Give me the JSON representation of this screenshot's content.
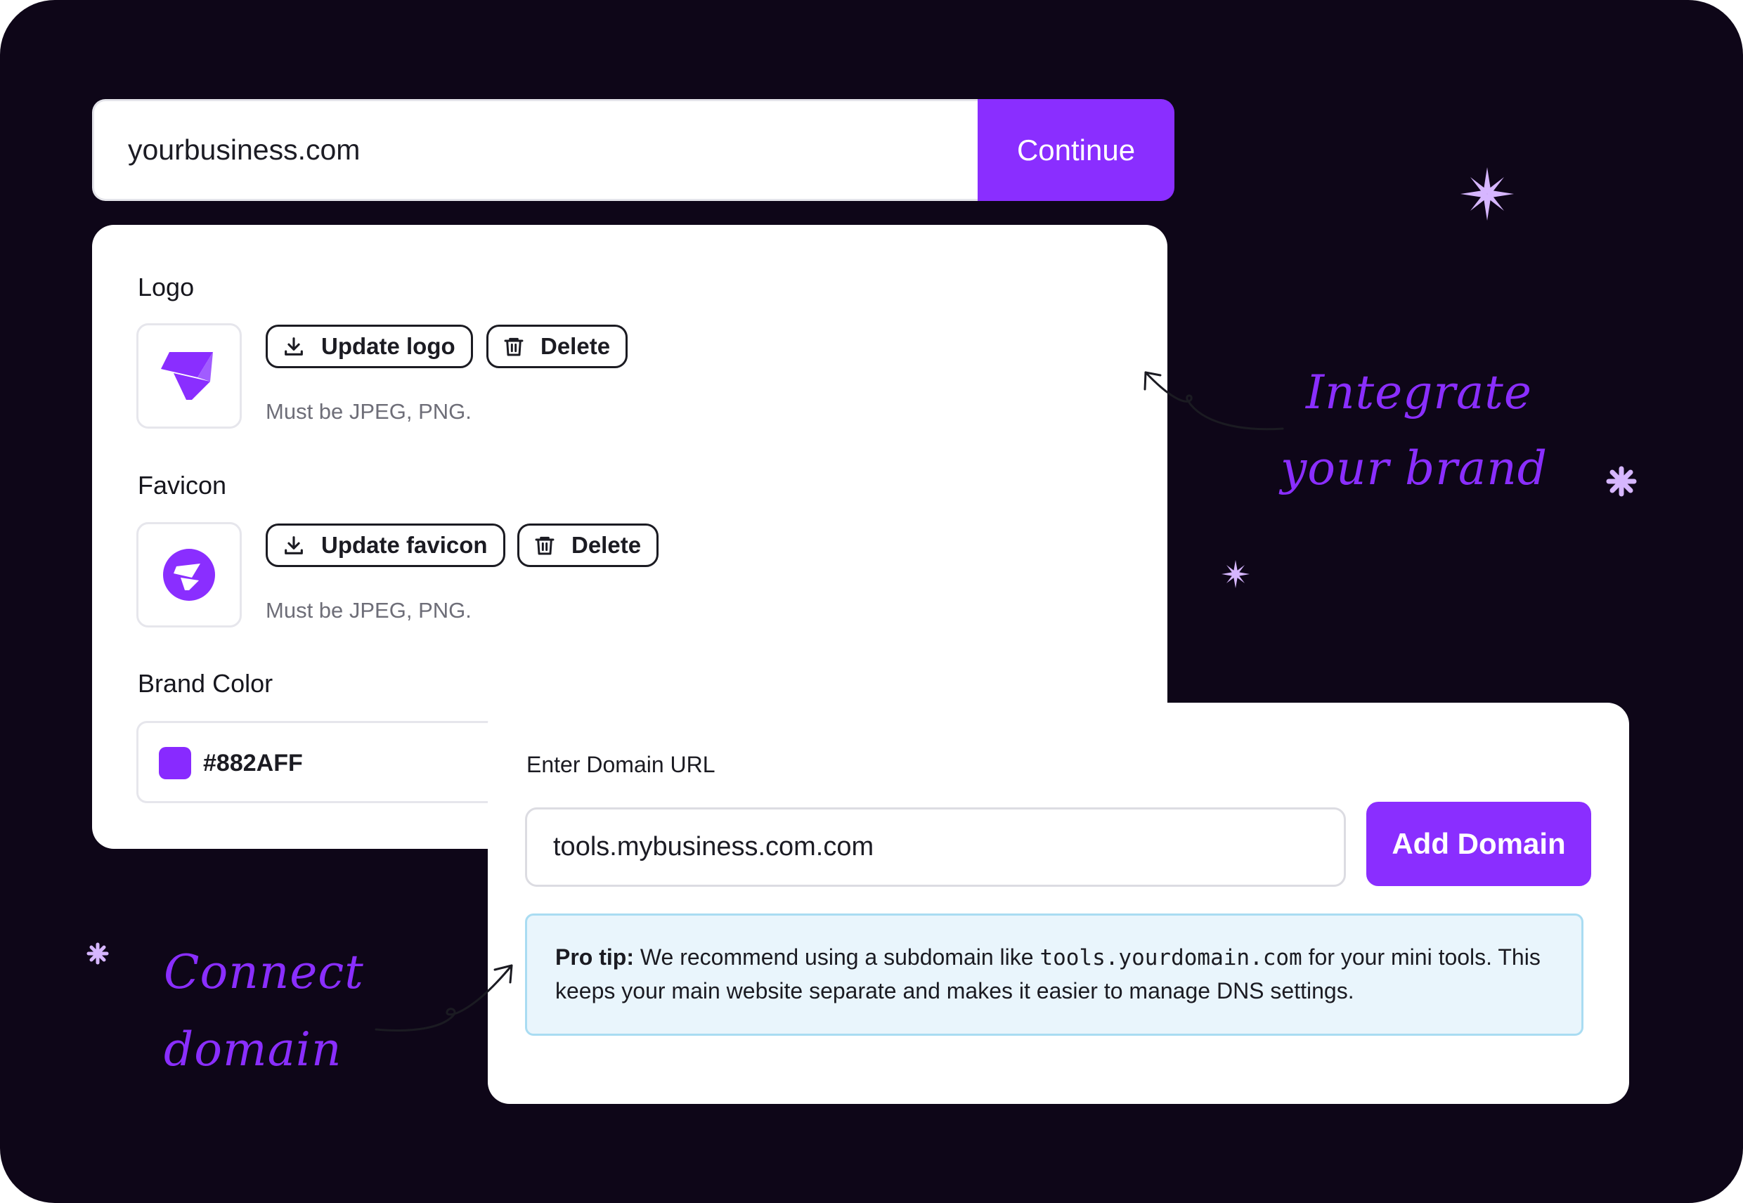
{
  "domain_bar": {
    "value": "yourbusiness.com",
    "button_label": "Continue"
  },
  "branding": {
    "logo": {
      "label": "Logo",
      "update_label": "Update logo",
      "delete_label": "Delete",
      "hint": "Must be JPEG, PNG.",
      "icon": "purple-origami-logo-icon"
    },
    "favicon": {
      "label": "Favicon",
      "update_label": "Update favicon",
      "delete_label": "Delete",
      "hint": "Must be JPEG, PNG.",
      "icon": "purple-circle-favicon-icon"
    },
    "brand_color": {
      "label": "Brand Color",
      "value": "#882AFF"
    }
  },
  "domain_setup": {
    "label": "Enter Domain URL",
    "input_value": "tools.mybusiness.com.com",
    "button_label": "Add Domain",
    "tip": {
      "title": "Pro tip:",
      "text_before": "We recommend using a subdomain like",
      "code": "tools.yourdomain.com",
      "text_after": "for your mini tools. This keeps your main website separate and makes it easier to manage DNS settings."
    }
  },
  "callouts": {
    "integrate_line1": "Integrate",
    "integrate_line2": "your brand",
    "connect_line1": "Connect",
    "connect_line2": "domain"
  },
  "colors": {
    "background": "#0e0618",
    "accent": "#8a2eff",
    "sparkle": "#d6b6ff",
    "tip_background": "#e9f5fc",
    "tip_border": "#a9dcf2"
  }
}
